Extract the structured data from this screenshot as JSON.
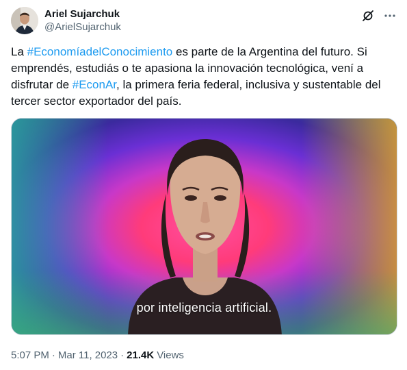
{
  "author": {
    "display_name": "Ariel Sujarchuk",
    "handle": "@ArielSujarchuk"
  },
  "tweet": {
    "segments": [
      {
        "text": "La ",
        "hashtag": false
      },
      {
        "text": "#EconomíadelConocimiento",
        "hashtag": true
      },
      {
        "text": " es parte de la Argentina del futuro. Si emprendés, estudiás o te apasiona la innovación tecnológica, vení a disfrutar de ",
        "hashtag": false
      },
      {
        "text": "#EconAr",
        "hashtag": true
      },
      {
        "text": ", la primera feria federal, inclusiva y sustentable del tercer sector exportador del país.",
        "hashtag": false
      }
    ]
  },
  "media": {
    "caption": "por inteligencia artificial."
  },
  "meta": {
    "time": "5:07 PM",
    "separator": "·",
    "date": "Mar 11, 2023",
    "separator2": "·",
    "views_count": "21.4K",
    "views_label": "Views"
  },
  "icons": {
    "grok": "grok-icon",
    "more": "more-icon"
  },
  "colors": {
    "link": "#1d9bf0",
    "secondary": "#536471",
    "primary": "#0f1419"
  }
}
